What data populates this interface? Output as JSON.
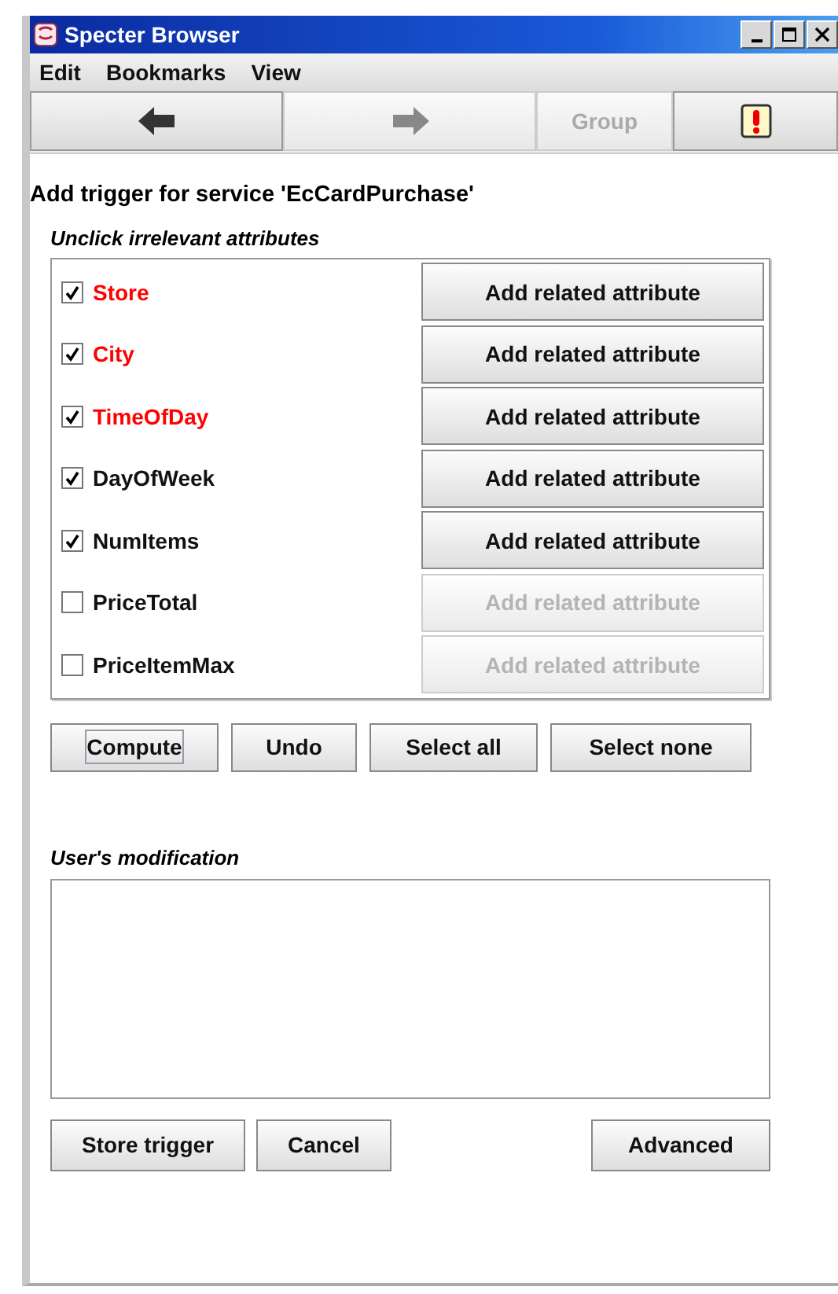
{
  "window": {
    "title": "Specter Browser"
  },
  "menu": [
    "Edit",
    "Bookmarks",
    "View"
  ],
  "toolbar": [
    {
      "kind": "back",
      "disabled": false
    },
    {
      "kind": "forward",
      "disabled": true
    },
    {
      "kind": "text",
      "label": "Group",
      "disabled": true
    },
    {
      "kind": "alert",
      "disabled": false
    }
  ],
  "heading": "Add trigger for service 'EcCardPurchase'",
  "attributes_label": "Unclick irrelevant attributes",
  "attributes": [
    {
      "name": "Store",
      "checked": true,
      "highlighted": true,
      "button": {
        "label": "Add related attribute",
        "disabled": false
      }
    },
    {
      "name": "City",
      "checked": true,
      "highlighted": true,
      "button": {
        "label": "Add related attribute",
        "disabled": false
      }
    },
    {
      "name": "TimeOfDay",
      "checked": true,
      "highlighted": true,
      "button": {
        "label": "Add related attribute",
        "disabled": false
      }
    },
    {
      "name": "DayOfWeek",
      "checked": true,
      "highlighted": false,
      "button": {
        "label": "Add related attribute",
        "disabled": false
      }
    },
    {
      "name": "NumItems",
      "checked": true,
      "highlighted": false,
      "button": {
        "label": "Add related attribute",
        "disabled": false
      }
    },
    {
      "name": "PriceTotal",
      "checked": false,
      "highlighted": false,
      "button": {
        "label": "Add related attribute",
        "disabled": true
      }
    },
    {
      "name": "PriceItemMax",
      "checked": false,
      "highlighted": false,
      "button": {
        "label": "Add related attribute",
        "disabled": true
      }
    }
  ],
  "actions": [
    {
      "label": "Compute",
      "focused": true
    },
    {
      "label": "Undo",
      "focused": false
    },
    {
      "label": "Select all",
      "focused": false
    },
    {
      "label": "Select none",
      "focused": false
    }
  ],
  "modification_label": "User's modification",
  "bottom_buttons": [
    {
      "label": "Store trigger",
      "kind": "left"
    },
    {
      "label": "Cancel",
      "kind": "left"
    },
    {
      "label": "Advanced",
      "kind": "right"
    }
  ]
}
